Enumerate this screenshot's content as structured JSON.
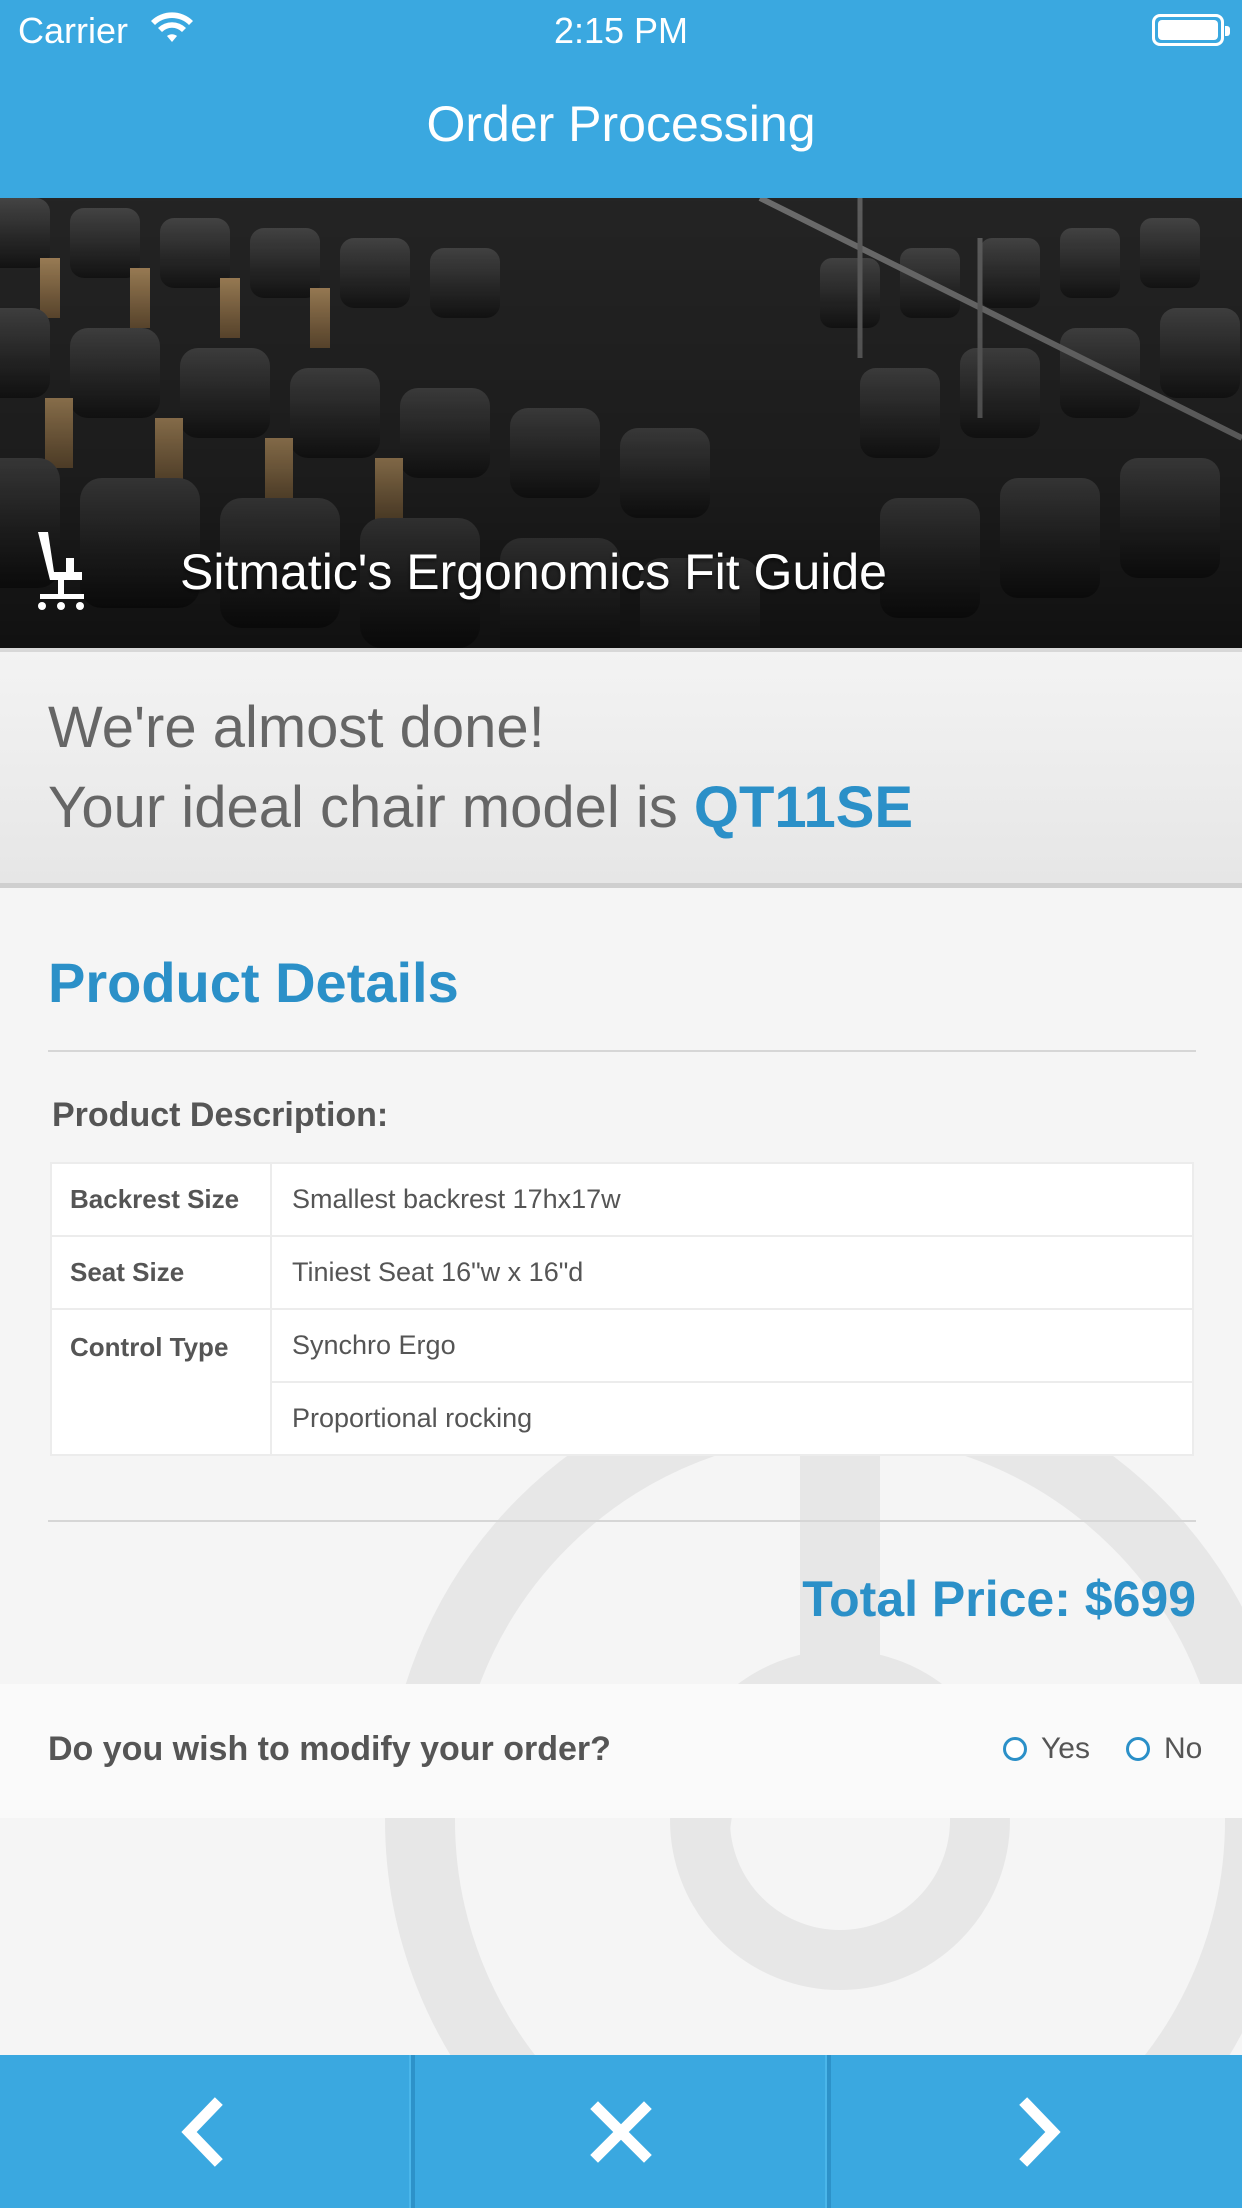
{
  "status_bar": {
    "carrier": "Carrier",
    "time": "2:15 PM",
    "icons": [
      "wifi-icon",
      "battery-icon"
    ]
  },
  "nav": {
    "title": "Order Processing"
  },
  "hero": {
    "title": "Sitmatic's Ergonomics Fit Guide",
    "icon": "office-chair-icon"
  },
  "banner": {
    "line1": "We're almost done!",
    "line2_prefix": "Your ideal chair model is ",
    "model": "QT11SE"
  },
  "details": {
    "section_title": "Product Details",
    "description_label": "Product Description:",
    "rows": [
      {
        "key": "Backrest Size",
        "value": "Smallest backrest 17hx17w"
      },
      {
        "key": "Seat Size",
        "value": "Tiniest Seat 16\"w x 16\"d"
      },
      {
        "key": "Control Type",
        "values": [
          "Synchro Ergo",
          "Proportional rocking"
        ]
      }
    ],
    "total": "Total Price: $699"
  },
  "modify": {
    "question": "Do you wish to modify your order?",
    "options": [
      "Yes",
      "No"
    ],
    "selected": null
  },
  "toolbar": {
    "buttons": [
      "back-chevron-icon",
      "close-icon",
      "forward-chevron-icon"
    ]
  },
  "colors": {
    "primary": "#3aa8e0",
    "accent": "#2b90c8",
    "text": "#555555"
  }
}
